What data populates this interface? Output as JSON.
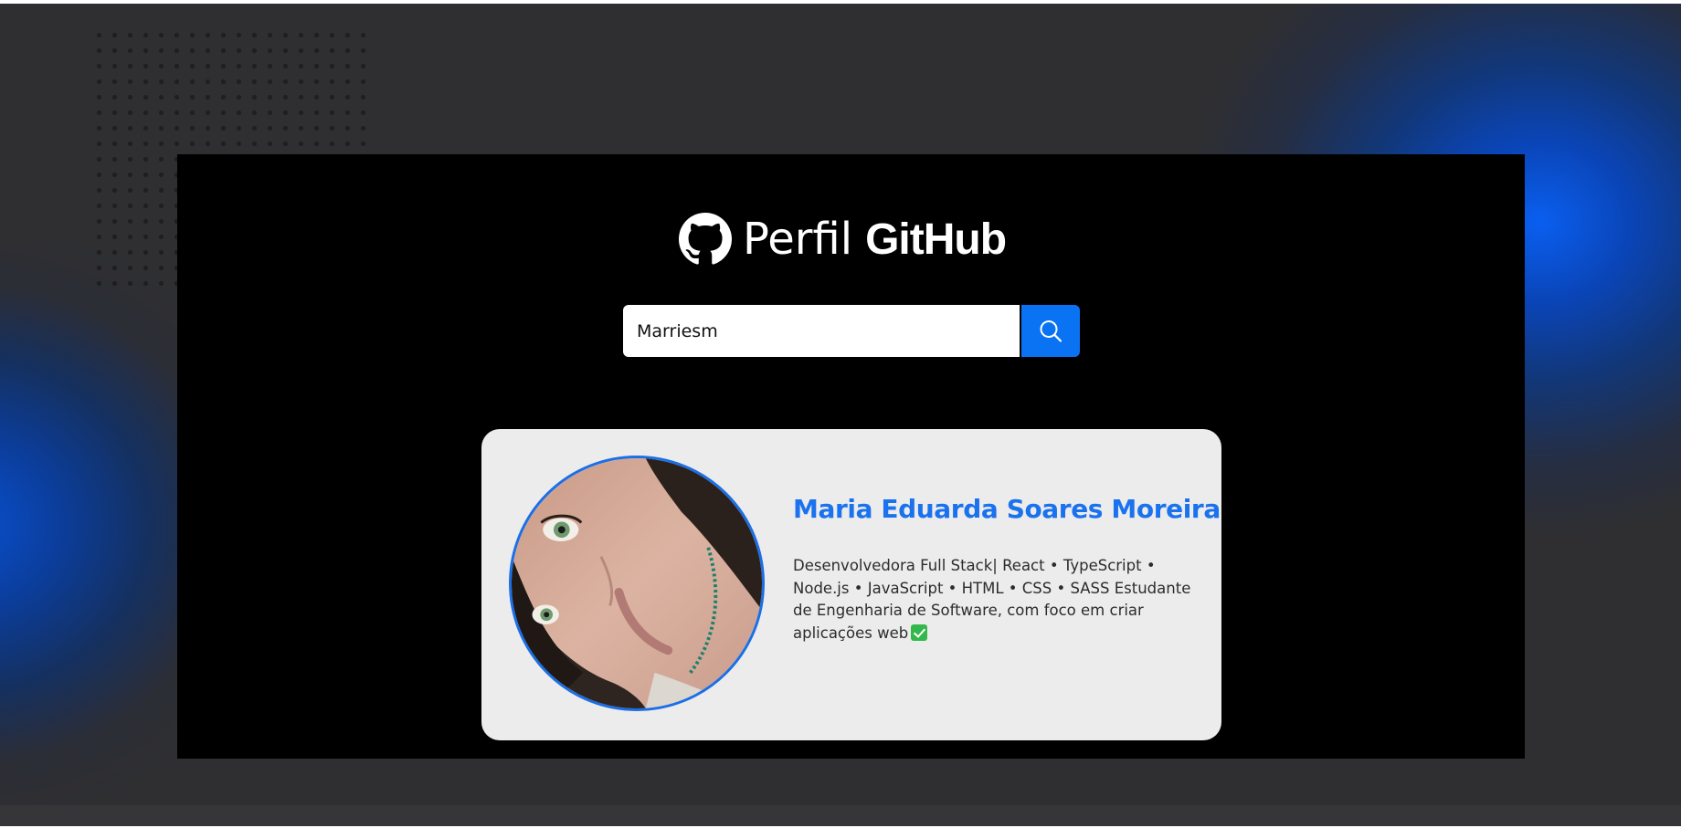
{
  "header": {
    "title_light": "Perfil",
    "title_bold": "GitHub",
    "logo_icon": "github-octocat-icon"
  },
  "search": {
    "value": "Marriesm",
    "button_icon": "search-icon"
  },
  "profile": {
    "name": "Maria Eduarda Soares Moreira",
    "bio": "Desenvolvedora Full Stack| React • TypeScript • Node.js • JavaScript • HTML • CSS • SASS Estudante de Engenharia de Software, com foco em criar aplicações web",
    "bio_emoji_icon": "check-mark-button-icon",
    "avatar_icon": "avatar-photo"
  },
  "colors": {
    "page_background": "#2f2f31",
    "panel_background": "#000000",
    "accent_blue": "#0a73f3",
    "name_blue": "#1a72ee",
    "card_background": "#ececec"
  }
}
